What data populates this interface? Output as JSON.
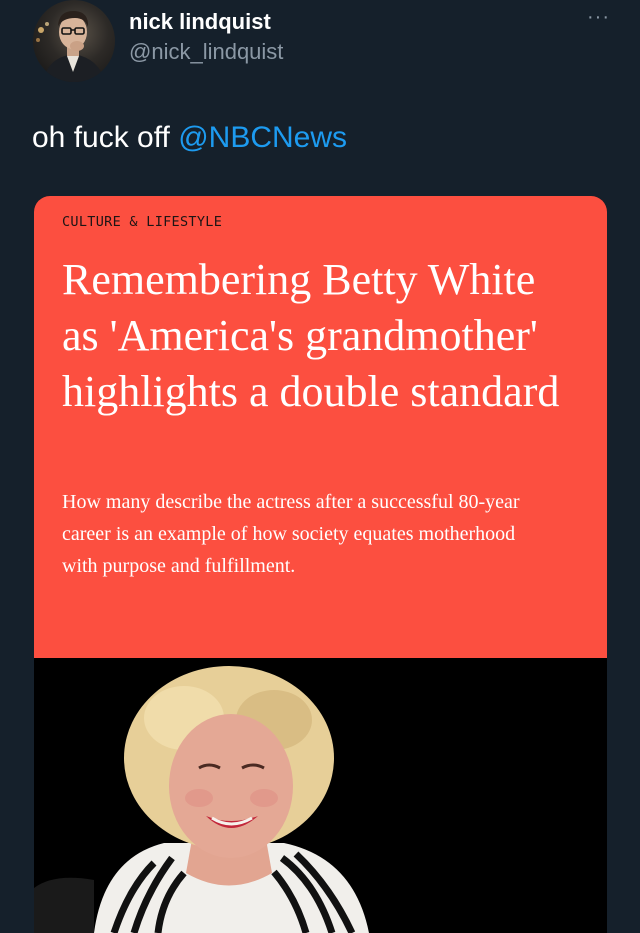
{
  "author": {
    "display_name": "nick lindquist",
    "handle": "@nick_lindquist"
  },
  "more_menu": "···",
  "tweet": {
    "text_prefix": "oh fuck off ",
    "mention": "@NBCNews"
  },
  "card": {
    "category": "CULTURE & LIFESTYLE",
    "headline": "Remembering Betty White as 'America's grandmother' highlights a double standard",
    "subheadline": "How many describe the actress after a successful 80-year career is an example of how society equates motherhood with purpose and fulfillment.",
    "accent_color": "#fc4f40"
  },
  "colors": {
    "background": "#15202b",
    "mention": "#1d9bf0",
    "secondary_text": "#8b98a5"
  }
}
